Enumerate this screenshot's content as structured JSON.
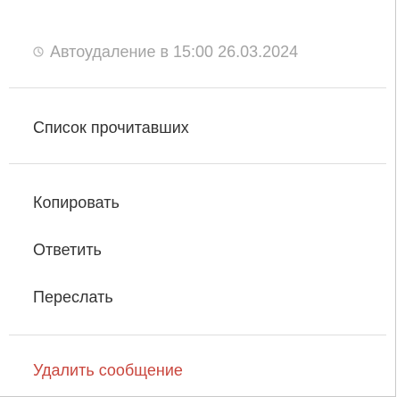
{
  "menu": {
    "autodelete": {
      "icon": "clock-icon",
      "text": "Автоудаление в 15:00 26.03.2024",
      "color": "#a3a3a3"
    },
    "read_list_label": "Список прочитавших",
    "copy_label": "Копировать",
    "reply_label": "Ответить",
    "forward_label": "Переслать",
    "delete_label": "Удалить сообщение",
    "delete_color": "#c9463d"
  }
}
